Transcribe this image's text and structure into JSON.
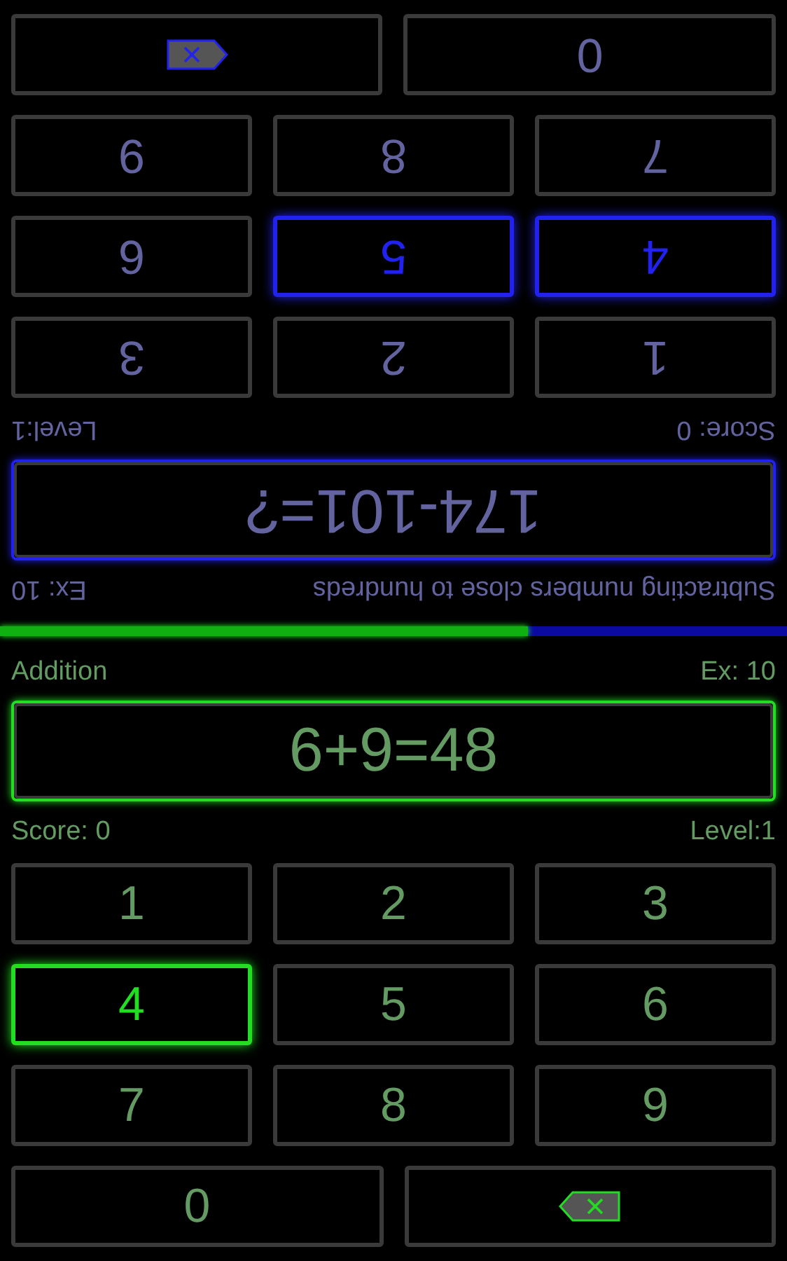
{
  "players": [
    {
      "color": "#2222ee",
      "rotated": true,
      "topic": "Subtracting numbers close to hundreds",
      "exercise": "Ex: 10",
      "question": "174-101=?",
      "score": "Score: 0",
      "level": "Level:1",
      "keys": [
        {
          "label": "1",
          "selected": false
        },
        {
          "label": "2",
          "selected": false
        },
        {
          "label": "3",
          "selected": false
        },
        {
          "label": "4",
          "selected": true
        },
        {
          "label": "5",
          "selected": true
        },
        {
          "label": "6",
          "selected": false
        },
        {
          "label": "7",
          "selected": false
        },
        {
          "label": "8",
          "selected": false
        },
        {
          "label": "9",
          "selected": false
        }
      ],
      "zero_key": {
        "label": "0",
        "selected": false
      }
    },
    {
      "color": "#22dd22",
      "rotated": false,
      "topic": "Addition",
      "exercise": "Ex: 10",
      "question": "6+9=48",
      "score": "Score: 0",
      "level": "Level:1",
      "keys": [
        {
          "label": "1",
          "selected": false
        },
        {
          "label": "2",
          "selected": false
        },
        {
          "label": "3",
          "selected": false
        },
        {
          "label": "4",
          "selected": true
        },
        {
          "label": "5",
          "selected": false
        },
        {
          "label": "6",
          "selected": false
        },
        {
          "label": "7",
          "selected": false
        },
        {
          "label": "8",
          "selected": false
        },
        {
          "label": "9",
          "selected": false
        }
      ],
      "zero_key": {
        "label": "0",
        "selected": false
      }
    }
  ],
  "progress": {
    "level": 0.67
  }
}
